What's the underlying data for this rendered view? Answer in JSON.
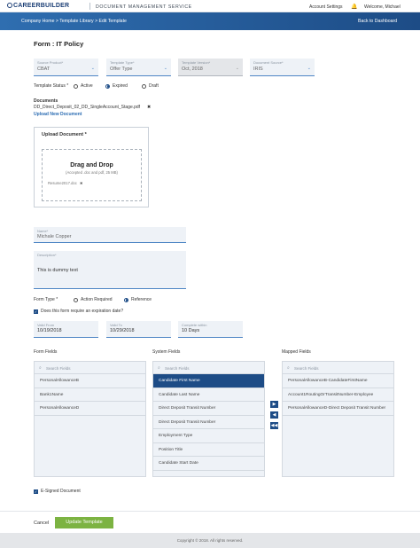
{
  "header": {
    "logo_text": "CAREERBUILDER",
    "app_name": "DOCUMENT MANAGEMENT SERVICE",
    "account_settings": "Account Settings",
    "welcome": "Welcome, Michael"
  },
  "nav": {
    "breadcrumb": "Company Home > Template Library > Edit Template",
    "back_label": "Back to Dashboard"
  },
  "form": {
    "title": "Form : IT Policy",
    "fields": [
      {
        "label": "Source Product*",
        "value": "CBAT"
      },
      {
        "label": "Template Type*",
        "value": "Offer Type"
      },
      {
        "label": "Template Version*",
        "value": "Oct, 2018"
      },
      {
        "label": "Document Source*",
        "value": "IRIS"
      }
    ],
    "template_status": {
      "label": "Template Status *",
      "options": [
        "Active",
        "Expired",
        "Draft"
      ],
      "selected": "Expired"
    }
  },
  "documents": {
    "heading": "Documents",
    "file": "DD_Direct_Deposit_02_DD_SingleAccount_Stage.pdf",
    "remove": "✖",
    "upload_link": "Upload New Document"
  },
  "upload": {
    "title": "Upload Document *",
    "drop_title": "Drag and Drop",
    "drop_sub": "(Accepted .doc and pdf, 25 MB)",
    "queued_file": "Resume2017.doc",
    "remove": "✖"
  },
  "name_field": {
    "label": "Name*",
    "value": "Michale Copper"
  },
  "description_field": {
    "label": "Description*",
    "value": "This is dummy text"
  },
  "form_type": {
    "label": "Form Type *",
    "options": [
      "Action Required",
      "Reference"
    ],
    "selected": "Reference"
  },
  "expiration": {
    "checkbox_label": "Does this form require an expiration date?",
    "valid_from": {
      "label": "Valid From",
      "value": "10/19/2018"
    },
    "valid_to": {
      "label": "Valid To",
      "value": "10/29/2018"
    },
    "complete_within": {
      "label": "Complete within",
      "value": "10 Days"
    }
  },
  "mapping": {
    "search_placeholder": "Search Fields",
    "form_fields": {
      "title": "Form Fields",
      "items": [
        "PersonalAllowanceB",
        "Bank1Name",
        "PersonalAllowanceD"
      ]
    },
    "system_fields": {
      "title": "System Fields",
      "items": [
        "Candidate First Name",
        "Candidate Last Name",
        "Direct Deposit Transit Number",
        "Direct Deposit Transit Number",
        "Employment Type",
        "Position Title",
        "Candidate Start Date"
      ],
      "selected_index": 0
    },
    "mapped_fields": {
      "title": "Mapped Fields",
      "items": [
        "PersonalAllowanceB-CandidateFirstName",
        "Account1RoutingOrTransitNumber-Employee",
        "PersonalAllowanceD-Direct Deposit Transit Number"
      ]
    },
    "arrows": [
      "▶",
      "◀",
      "◀◀"
    ]
  },
  "esigned": {
    "label": "E-Signed Document"
  },
  "actions": {
    "cancel": "Cancel",
    "update": "Update Template"
  },
  "footer": {
    "copyright": "Copyright © 2018. All rights reserved."
  },
  "colors": {
    "primary": "#1d4c86",
    "accent": "#4e86c5",
    "success": "#7cb342"
  }
}
